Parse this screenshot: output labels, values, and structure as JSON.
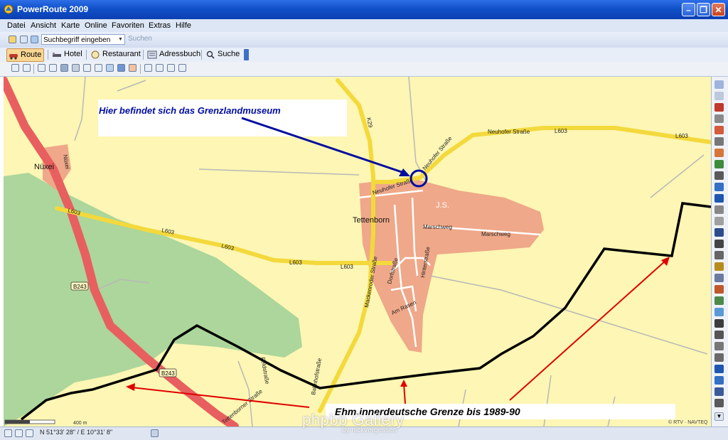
{
  "window": {
    "title": "PowerRoute 2009"
  },
  "menu": [
    "Datei",
    "Ansicht",
    "Karte",
    "Online",
    "Favoriten",
    "Extras",
    "Hilfe"
  ],
  "search": {
    "value": "Suchbegriff eingeben",
    "button": "Suchen"
  },
  "toolbar": {
    "route": "Route",
    "hotel": "Hotel",
    "restaurant": "Restaurant",
    "adressbuch": "Adressbuch",
    "suche": "Suche"
  },
  "map": {
    "places": {
      "nuxei": "Nüxei",
      "tettenborn": "Tettenborn",
      "js": "J.S."
    },
    "roads": {
      "k29": "K29",
      "l603": "L603",
      "b243": "B243",
      "neuhofer_strasse": "Neuhofer Straße",
      "marschweg": "Marschweg",
      "mackenroder_strasse": "Mackenroder Straße",
      "dorfstrasse": "Dorfstraße",
      "hinterstrasse": "Hinterstraße",
      "am_rasen": "Am Rasen",
      "feldstrasse": "Feldstraße",
      "nueixei": "Nüxei",
      "bahnhofstrasse": "Bahnhofstraße",
      "tettenborner_strasse": "Tettenborner Straße"
    },
    "annotation_museum": "Hier befindet sich das Grenzlandmuseum",
    "annotation_border": "Ehm.innerdeutsche Grenze bis 1989-90",
    "scale": "400 m",
    "copyright": "© RTV · NAVTEQ"
  },
  "status": {
    "coords": "N 51°33' 28\" / E 10°31' 8\""
  },
  "watermark": {
    "main": "phpbb Gallery",
    "sub": "by nickvergessen"
  },
  "colors": {
    "map_bg": "#fdf6b4",
    "forest": "#acd69b",
    "town": "#efa889",
    "road_yellow": "#f3d93c",
    "road_red": "#e85f5f",
    "border_line": "#000000",
    "annotation_blue": "#000ca0",
    "arrow_red": "#e00000"
  }
}
